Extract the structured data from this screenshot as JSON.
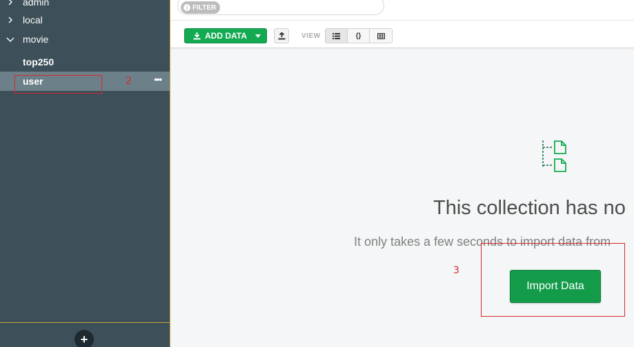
{
  "sidebar": {
    "databases": [
      {
        "name": "admin",
        "expanded": false
      },
      {
        "name": "local",
        "expanded": false
      },
      {
        "name": "movie",
        "expanded": true
      }
    ],
    "collections": [
      {
        "name": "top250",
        "selected": false
      },
      {
        "name": "user",
        "selected": true
      }
    ],
    "more_label": "•••",
    "add_label": "+"
  },
  "filter": {
    "tag_label": "FILTER",
    "info_glyph": "i"
  },
  "toolbar": {
    "add_data_label": "ADD DATA",
    "view_label": "VIEW",
    "view_modes": [
      "list",
      "json",
      "table"
    ],
    "active_view": "list"
  },
  "empty_state": {
    "title": "This collection has no",
    "subtitle": "It only takes a few seconds to import data from",
    "import_label": "Import Data"
  },
  "annotations": {
    "two": "2",
    "three": "3"
  },
  "colors": {
    "sidebar_bg": "#3d4f58",
    "selected_bg": "#6c8089",
    "accent_green": "#13aa52",
    "annotation_red": "#d6282f",
    "icon_green": "#13aa52"
  }
}
